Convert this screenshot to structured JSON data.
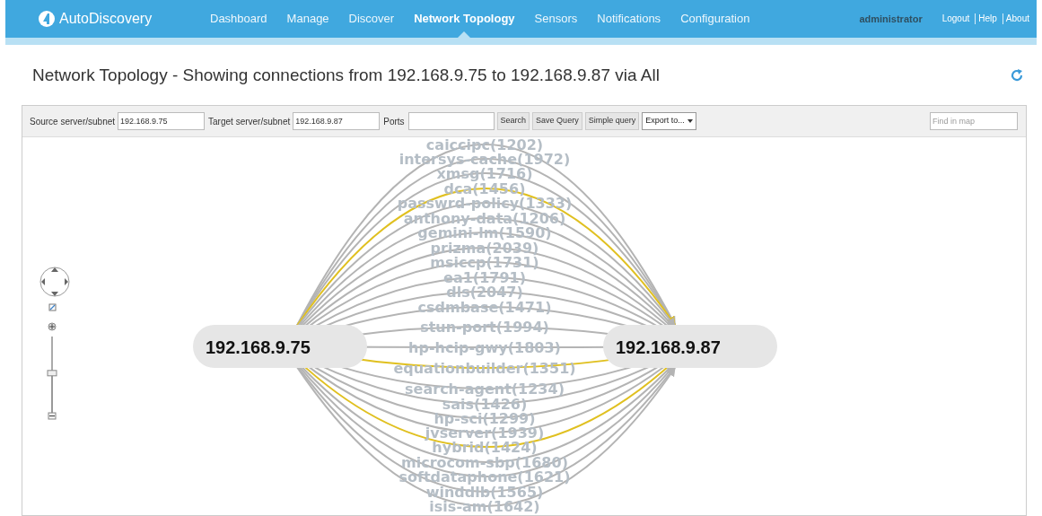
{
  "app": {
    "name": "AutoDiscovery"
  },
  "nav": [
    {
      "label": "Dashboard",
      "selected": false
    },
    {
      "label": "Manage",
      "selected": false
    },
    {
      "label": "Discover",
      "selected": false
    },
    {
      "label": "Network Topology",
      "selected": true
    },
    {
      "label": "Sensors",
      "selected": false
    },
    {
      "label": "Notifications",
      "selected": false
    },
    {
      "label": "Configuration",
      "selected": false
    }
  ],
  "user": "administrator",
  "user_links": [
    "Logout",
    "Help",
    "About"
  ],
  "page_title": "Network Topology - Showing connections from 192.168.9.75 to 192.168.9.87 via All",
  "toolbar": {
    "source_label": "Source server/subnet",
    "source_value": "192.168.9.75",
    "target_label": "Target server/subnet",
    "target_value": "192.168.9.87",
    "ports_label": "Ports",
    "buttons": [
      "Search",
      "Save Query",
      "Simple query"
    ],
    "export": "Export to...",
    "find_placeholder": "Find in map"
  },
  "zoom": {
    "level": 0.52
  },
  "source_node": "192.168.9.75",
  "target_node": "192.168.9.87",
  "edges": [
    {
      "label": "caiccipc(1202)",
      "kind": "normal"
    },
    {
      "label": "intersys-cache(1972)",
      "kind": "normal"
    },
    {
      "label": "xmsg(1716)",
      "kind": "normal"
    },
    {
      "label": "dca(1456)",
      "kind": "highlighted"
    },
    {
      "label": "passwrd-policy(1333)",
      "kind": "normal"
    },
    {
      "label": "anthony-data(1206)",
      "kind": "normal"
    },
    {
      "label": "gemini-lm(1590)",
      "kind": "normal"
    },
    {
      "label": "prizma(2039)",
      "kind": "normal"
    },
    {
      "label": "msiccp(1731)",
      "kind": "normal"
    },
    {
      "label": "ea1(1791)",
      "kind": "normal"
    },
    {
      "label": "dls(2047)",
      "kind": "normal"
    },
    {
      "label": "csdmbase(1471)",
      "kind": "normal"
    },
    {
      "label": "stun-port(1994)",
      "kind": "normal"
    },
    {
      "label": "hp-hcip-gwy(1803)",
      "kind": "normal"
    },
    {
      "label": "equationbuilder(1351)",
      "kind": "highlighted"
    },
    {
      "label": "search-agent(1234)",
      "kind": "normal"
    },
    {
      "label": "sais(1426)",
      "kind": "normal"
    },
    {
      "label": "hp-sci(1299)",
      "kind": "normal"
    },
    {
      "label": "jvserver(1939)",
      "kind": "normal"
    },
    {
      "label": "hybrid(1424)",
      "kind": "highlighted"
    },
    {
      "label": "microcom-sbp(1680)",
      "kind": "normal"
    },
    {
      "label": "softdataphone(1621)",
      "kind": "normal"
    },
    {
      "label": "winddlb(1565)",
      "kind": "normal"
    },
    {
      "label": "isis-am(1642)",
      "kind": "normal"
    }
  ]
}
